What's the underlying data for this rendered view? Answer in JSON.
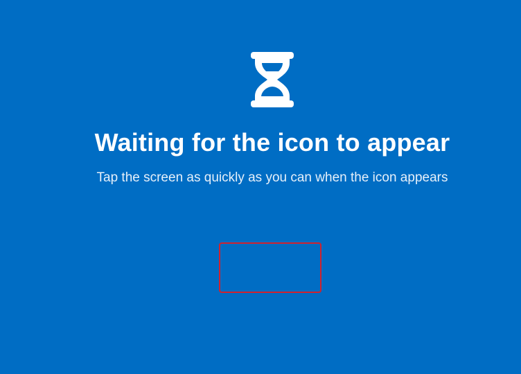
{
  "screen": {
    "title": "Waiting for the icon to appear",
    "subtitle": "Tap the screen as quickly as you can when the icon appears",
    "background_color": "#006dc4",
    "highlight_color": "#d2222d",
    "icon": "hourglass-icon"
  }
}
